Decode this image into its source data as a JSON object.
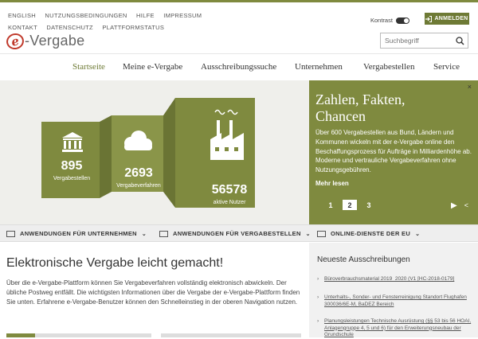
{
  "top_links": [
    "ENGLISH",
    "NUTZUNGSBEDINGUNGEN",
    "HILFE",
    "IMPRESSUM",
    "KONTAKT",
    "DATENSCHUTZ",
    "PLATTFORMSTATUS"
  ],
  "logo": {
    "letter": "e",
    "text": "-Vergabe"
  },
  "kontrast_label": "Kontrast",
  "login_label": "ANMELDEN",
  "search": {
    "placeholder": "Suchbegriff"
  },
  "nav": [
    "Startseite",
    "Meine e-Vergabe",
    "Ausschreibungssuche",
    "Unternehmen",
    "Vergabestellen",
    "Service"
  ],
  "stats": [
    {
      "value": "895",
      "label": "Vergabestellen",
      "icon": "building-icon"
    },
    {
      "value": "2693",
      "label": "Vergabeverfahren",
      "icon": "cloud-icon"
    },
    {
      "value": "56578",
      "label": "aktive Nutzer",
      "icon": "factory-icon"
    }
  ],
  "hero": {
    "title": "Zahlen, Fakten, Chancen",
    "text": "Über 600 Vergabestellen aus Bund, Ländern und Kommunen wickeln mit der e-Vergabe online den Beschaffungsprozess für Aufträge in Milliardenhöhe ab. Moderne und vertrauliche Vergabeverfahren ohne Nutzungsgebühren.",
    "more": "Mehr lesen",
    "pages": [
      "1",
      "2",
      "3"
    ],
    "close": "×"
  },
  "tabs": [
    "ANWENDUNGEN FÜR UNTERNEHMEN",
    "ANWENDUNGEN FÜR VERGABESTELLEN",
    "ONLINE-DIENSTE DER EU"
  ],
  "main": {
    "title": "Elektronische Vergabe leicht gemacht!",
    "text": "Über die e-Vergabe-Plattform können Sie Vergabeverfahren vollständig elektronisch abwickeln. Der übliche Postweg entfällt. Die wichtigsten Informationen über die Vergabe der e-Vergabe-Plattform finden Sie unten. Erfahrene e-Vergabe-Benutzer können den Schnelleinstieg in der oberen Navigation nutzen."
  },
  "side": {
    "title": "Neueste Ausschreibungen",
    "items": [
      "Büroverbrauchsmaterial 2019_2020 (V1 [HC-2018-0179]",
      "Unterhalts-, Sonder- und Fensterreinigung Standort Flughafen 300036/6E-M, BaDEZ Bereich",
      "Planungsleistungen Technische Ausrüstung (§§ 53 bis 56 HOAI, Anlagengruppe 4, 5 und 6) für den Erweiterungsneubau der Grundschule"
    ]
  },
  "colors": {
    "accent": "#7f8a3f",
    "dark_accent": "#6e7a35",
    "red_logo": "#c0392b"
  }
}
